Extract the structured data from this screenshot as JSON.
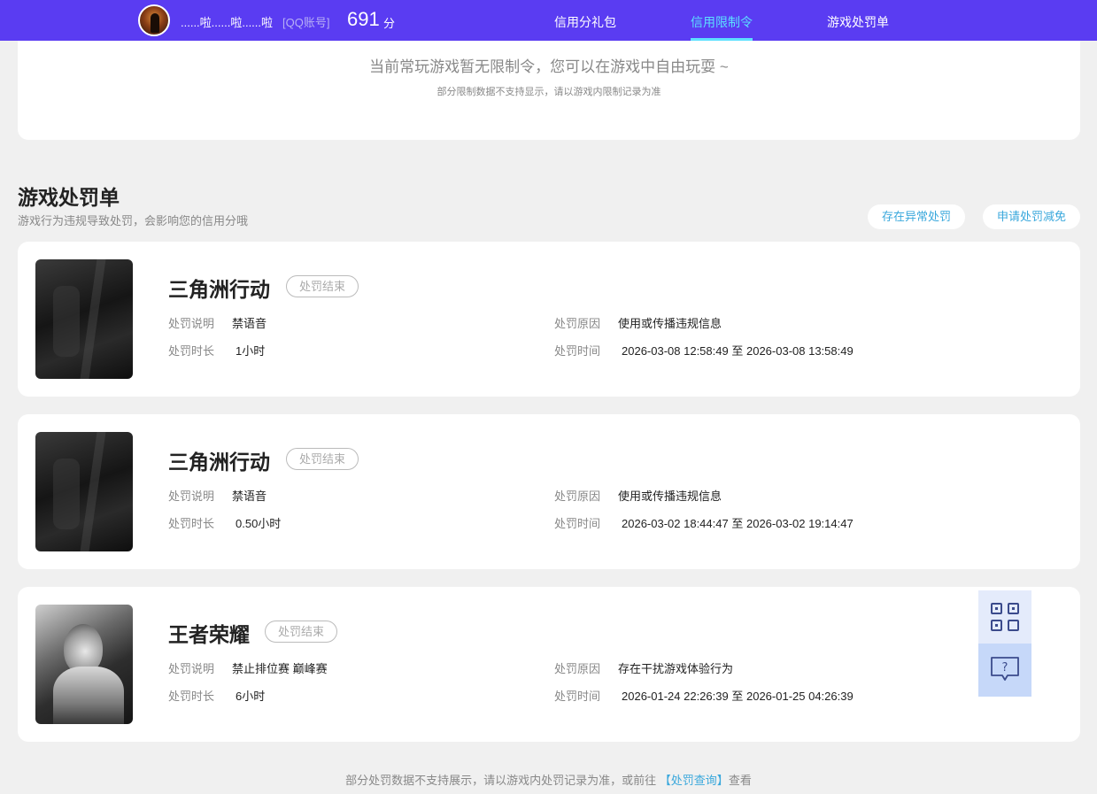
{
  "header": {
    "username": "......啦......啦......啦",
    "account_type": "[QQ账号]",
    "score": "691",
    "score_unit": "分",
    "nav": [
      {
        "label": "信用分礼包"
      },
      {
        "label": "信用限制令"
      },
      {
        "label": "游戏处罚单"
      }
    ],
    "active_nav": "信用限制令"
  },
  "restriction": {
    "main_text": "当前常玩游戏暂无限制令，您可以在游戏中自由玩耍 ~",
    "sub_text": "部分限制数据不支持显示，请以游戏内限制记录为准"
  },
  "penalty_section": {
    "title": "游戏处罚单",
    "subtitle": "游戏行为违规导致处罚，会影响您的信用分哦",
    "btn_abnormal": "存在异常处罚",
    "btn_reduce": "申请处罚减免"
  },
  "labels": {
    "desc": "处罚说明",
    "duration": "处罚时长",
    "reason": "处罚原因",
    "time": "处罚时间",
    "to": "至"
  },
  "penalties": [
    {
      "game": "三角洲行动",
      "status": "处罚结束",
      "desc": "禁语音",
      "duration": "1小时",
      "reason": "使用或传播违规信息",
      "start": "2026-03-08 12:58:49",
      "end": "2026-03-08 13:58:49"
    },
    {
      "game": "三角洲行动",
      "status": "处罚结束",
      "desc": "禁语音",
      "duration": "0.50小时",
      "reason": "使用或传播违规信息",
      "start": "2026-03-02 18:44:47",
      "end": "2026-03-02 19:14:47"
    },
    {
      "game": "王者荣耀",
      "status": "处罚结束",
      "desc": "禁止排位赛 巅峰赛",
      "duration": "6小时",
      "reason": "存在干扰游戏体验行为",
      "start": "2026-01-24 22:26:39",
      "end": "2026-01-25 04:26:39"
    }
  ],
  "side_buttons": [
    {
      "icon": "qr-code-icon"
    },
    {
      "icon": "help-chat-icon"
    }
  ],
  "footer": {
    "text_before": "部分处罚数据不支持展示，请以游戏内处罚记录为准，或前往",
    "link": "【处罚查询】",
    "text_after": "查看"
  },
  "colors": {
    "header_bg": "#5a3cf2",
    "nav_active": "#5ce0ff",
    "link": "#3aa8dc",
    "page_bg": "#f0f0f0"
  }
}
